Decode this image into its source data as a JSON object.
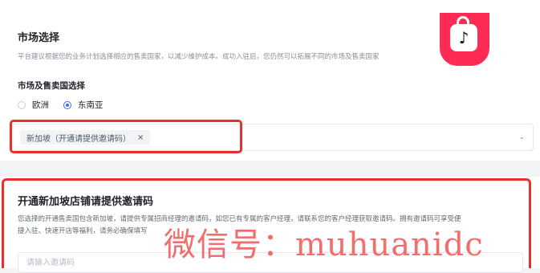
{
  "market": {
    "title": "市场选择",
    "description": "平台建议根据您的业务计划选择相应的售卖国家，以减少维护成本。成功入驻后，您仍然可以拓展不同的市场及售卖国家",
    "subtitle": "市场及售卖国选择",
    "options": [
      {
        "label": "欧洲",
        "checked": false
      },
      {
        "label": "东南亚",
        "checked": true
      }
    ],
    "selected_tag": "新加坡（开通请提供邀请码）",
    "tag_remove": "×",
    "dropdown_icon": "⌄"
  },
  "invite": {
    "title": "开通新加坡店铺请提供邀请码",
    "description_line1": "您选择的开通售卖国包含新加坡，请提供专属招商经理的邀请码，如您已有专属的客户经理，请联系您的客户经理获取邀请码。拥有邀请码可享受便",
    "description_line2": "捷入驻、快速开店等福利，请务必确保填写",
    "input_placeholder": "请输入邀请码"
  },
  "watermark": "微信号：muhuanidc",
  "logo": {
    "icon": "tiktok-shop-icon",
    "glyph": "♪"
  },
  "colors": {
    "accent": "#3370ff",
    "highlight": "#e5322d",
    "brand": "#fe2c55"
  }
}
